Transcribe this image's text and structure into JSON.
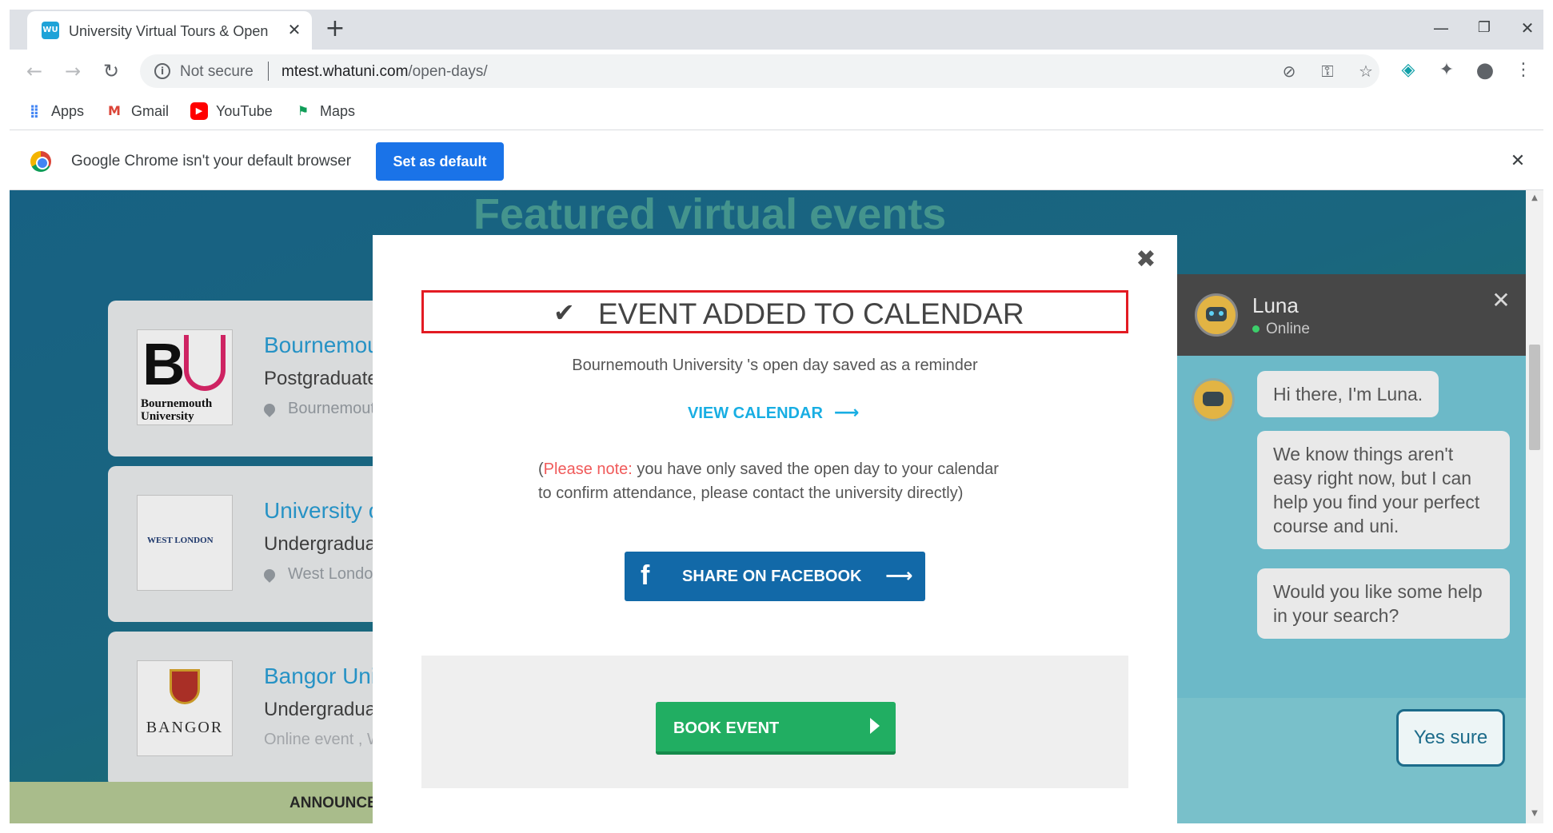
{
  "browser": {
    "tab": {
      "title": "University Virtual Tours & Open Days",
      "favicon_text": "WU"
    },
    "omnibox": {
      "security_label": "Not secure",
      "url_domain": "mtest.whatuni.com",
      "url_path": "/open-days/"
    },
    "bookmarks": [
      {
        "label": "Apps",
        "icon": "apps-grid-icon"
      },
      {
        "label": "Gmail",
        "icon": "gmail-icon"
      },
      {
        "label": "YouTube",
        "icon": "youtube-icon"
      },
      {
        "label": "Maps",
        "icon": "maps-icon"
      }
    ],
    "infobar": {
      "message": "Google Chrome isn't your default browser",
      "button_label": "Set as default"
    }
  },
  "page": {
    "heading": "Featured virtual events",
    "cards": [
      {
        "name": "Bournemouth University",
        "type": "Postgraduate",
        "location": "Bournemouth",
        "logo_text": "Bournemouth University"
      },
      {
        "name": "University of West London",
        "type": "Undergraduate",
        "location": "West London",
        "logo_text": "WEST LONDON"
      },
      {
        "name": "Bangor University",
        "type": "Undergraduate",
        "location": "Online event , Wales",
        "logo_text": "BANGOR"
      }
    ],
    "announcement": "ANNOUNCEMENT"
  },
  "modal": {
    "title": "EVENT ADDED TO CALENDAR",
    "saved_message": "Bournemouth University 's open day saved as a reminder",
    "view_calendar": "VIEW CALENDAR",
    "note_open": "(",
    "note_label": "Please note:",
    "note_line1": " you have only saved the open day to your calendar",
    "note_line2": "to confirm attendance, please contact the university directly)",
    "facebook_button": "SHARE ON FACEBOOK",
    "book_button": "BOOK EVENT"
  },
  "chat": {
    "bot_name": "Luna",
    "status": "Online",
    "messages": [
      "Hi there, I'm Luna.",
      "We know things aren't easy right now, but I can help you find your perfect course and uni.",
      "Would you like some help in your search?"
    ],
    "reply_button": "Yes sure"
  },
  "colors": {
    "accent_blue": "#18aee3",
    "facebook_blue": "#1269a8",
    "book_green": "#21ae62",
    "highlight_red": "#e31b23",
    "note_red": "#f05a5a"
  }
}
